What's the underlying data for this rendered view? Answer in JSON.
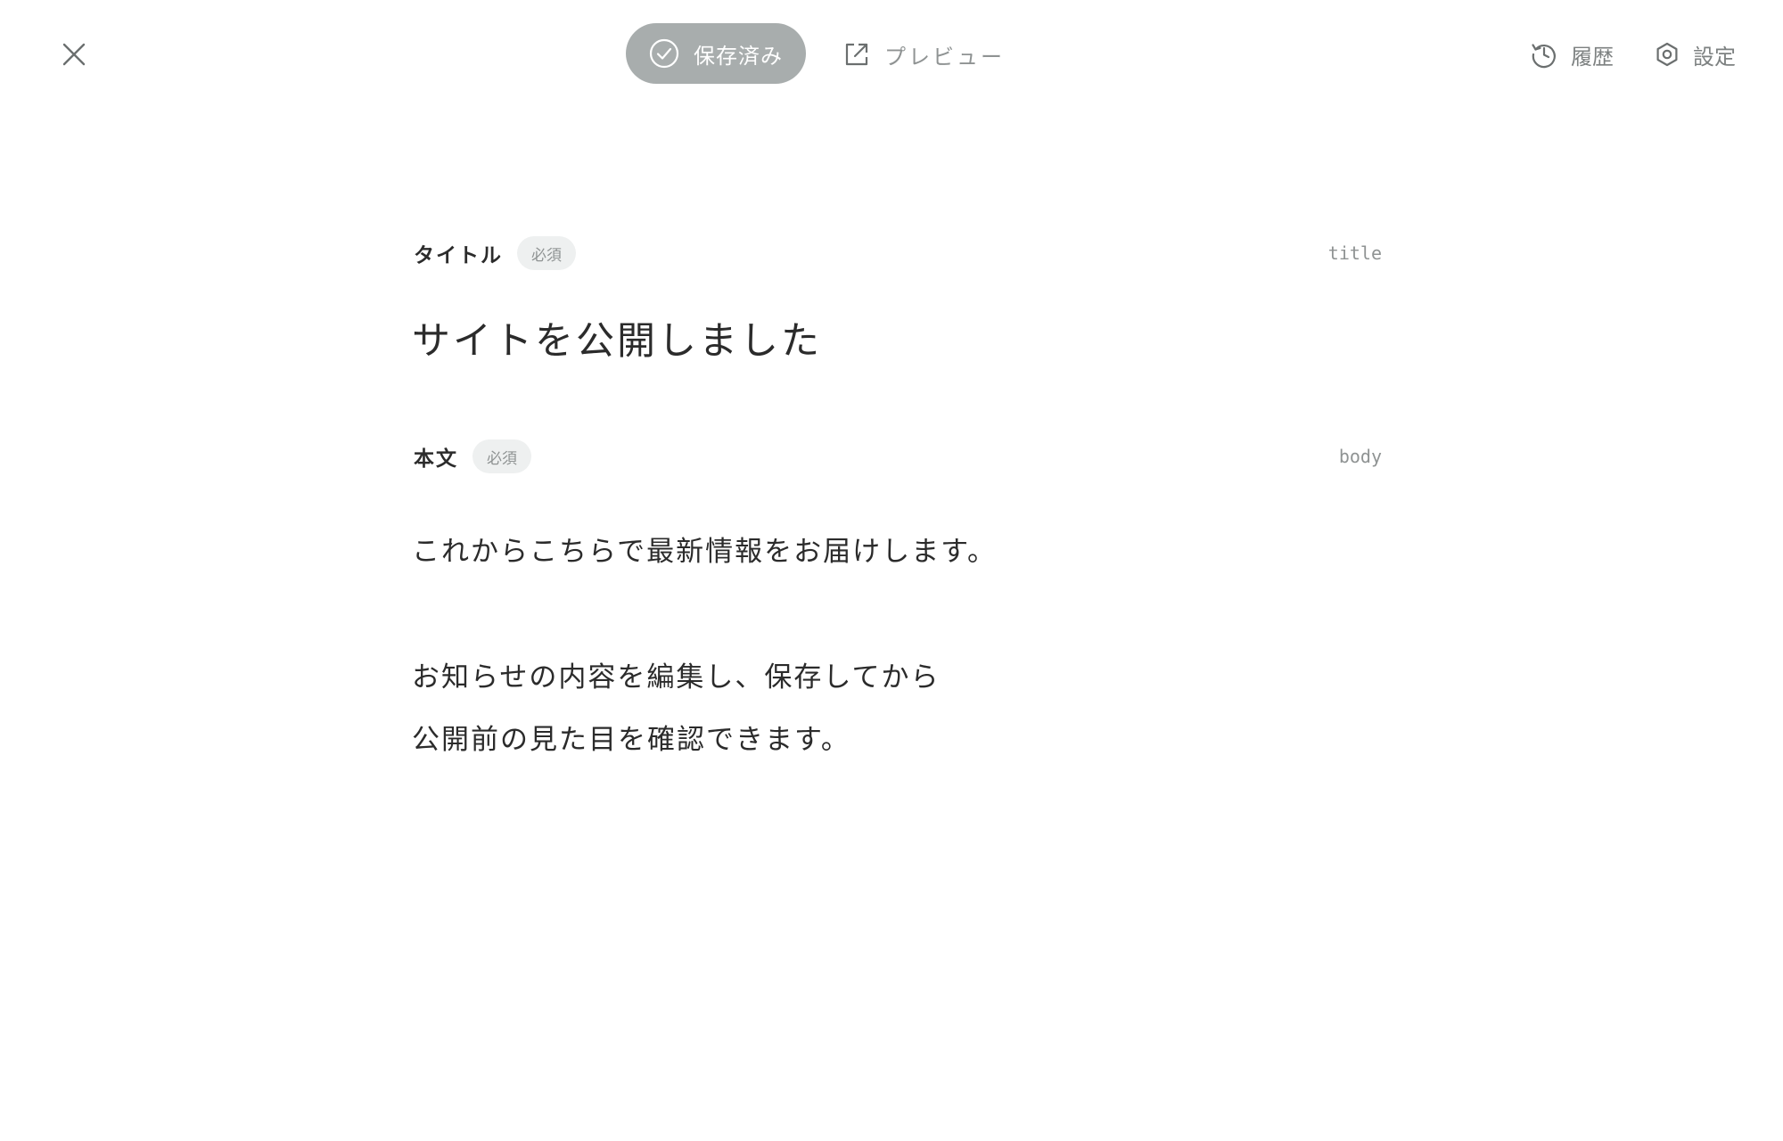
{
  "toolbar": {
    "close_icon": "close-icon",
    "saved_label": "保存済み",
    "saved_icon": "check-circle-icon",
    "preview_label": "プレビュー",
    "preview_icon": "external-link-icon",
    "history_label": "履歴",
    "history_icon": "history-icon",
    "settings_label": "設定",
    "settings_icon": "gear-icon",
    "saved_bg": "#a8adad"
  },
  "fields": {
    "title": {
      "label": "タイトル",
      "badge": "必須",
      "key": "title",
      "value": "サイトを公開しました"
    },
    "body": {
      "label": "本文",
      "badge": "必須",
      "key": "body",
      "lines": [
        "これからこちらで最新情報をお届けします。",
        "お知らせの内容を編集し、保存してから",
        "公開前の見た目を確認できます。"
      ]
    }
  }
}
